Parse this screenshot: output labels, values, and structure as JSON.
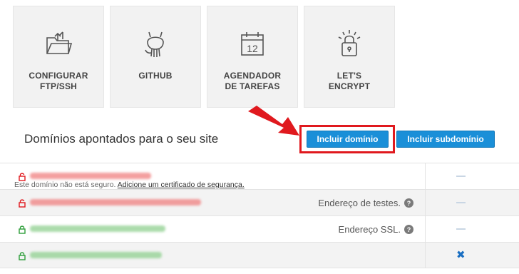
{
  "tiles": [
    {
      "label": "CONFIGURAR\nFTP/SSH",
      "icon": "folder-upload-icon"
    },
    {
      "label": "GITHUB",
      "icon": "github-icon"
    },
    {
      "label": "AGENDADOR\nDE TAREFAS",
      "icon": "calendar-icon",
      "calendar_day": "12"
    },
    {
      "label": "LET'S\nENCRYPT",
      "icon": "padlock-light-icon"
    }
  ],
  "section": {
    "title": "Domínios apontados para o seu site",
    "add_domain_label": "Incluir domínio",
    "add_subdomain_label": "Incluir subdomínio"
  },
  "domains": [
    {
      "secure": false,
      "warning": "Este domínio não está seguro.",
      "warning_link": "Adicione um certificado de segurança.",
      "tag": "",
      "action": "minus"
    },
    {
      "secure": false,
      "warning": "",
      "warning_link": "",
      "tag": "Endereço de testes.",
      "help": "?",
      "action": "minus"
    },
    {
      "secure": true,
      "warning": "",
      "warning_link": "",
      "tag": "Endereço SSL.",
      "help": "?",
      "action": "minus"
    },
    {
      "secure": true,
      "warning": "",
      "warning_link": "",
      "tag": "",
      "action": "remove",
      "action_symbol": "✖"
    }
  ],
  "colors": {
    "primary_button": "#1a8fd8",
    "highlight": "#e0191e",
    "insecure_lock": "#e0191e",
    "secure_lock": "#2e9e3a"
  }
}
